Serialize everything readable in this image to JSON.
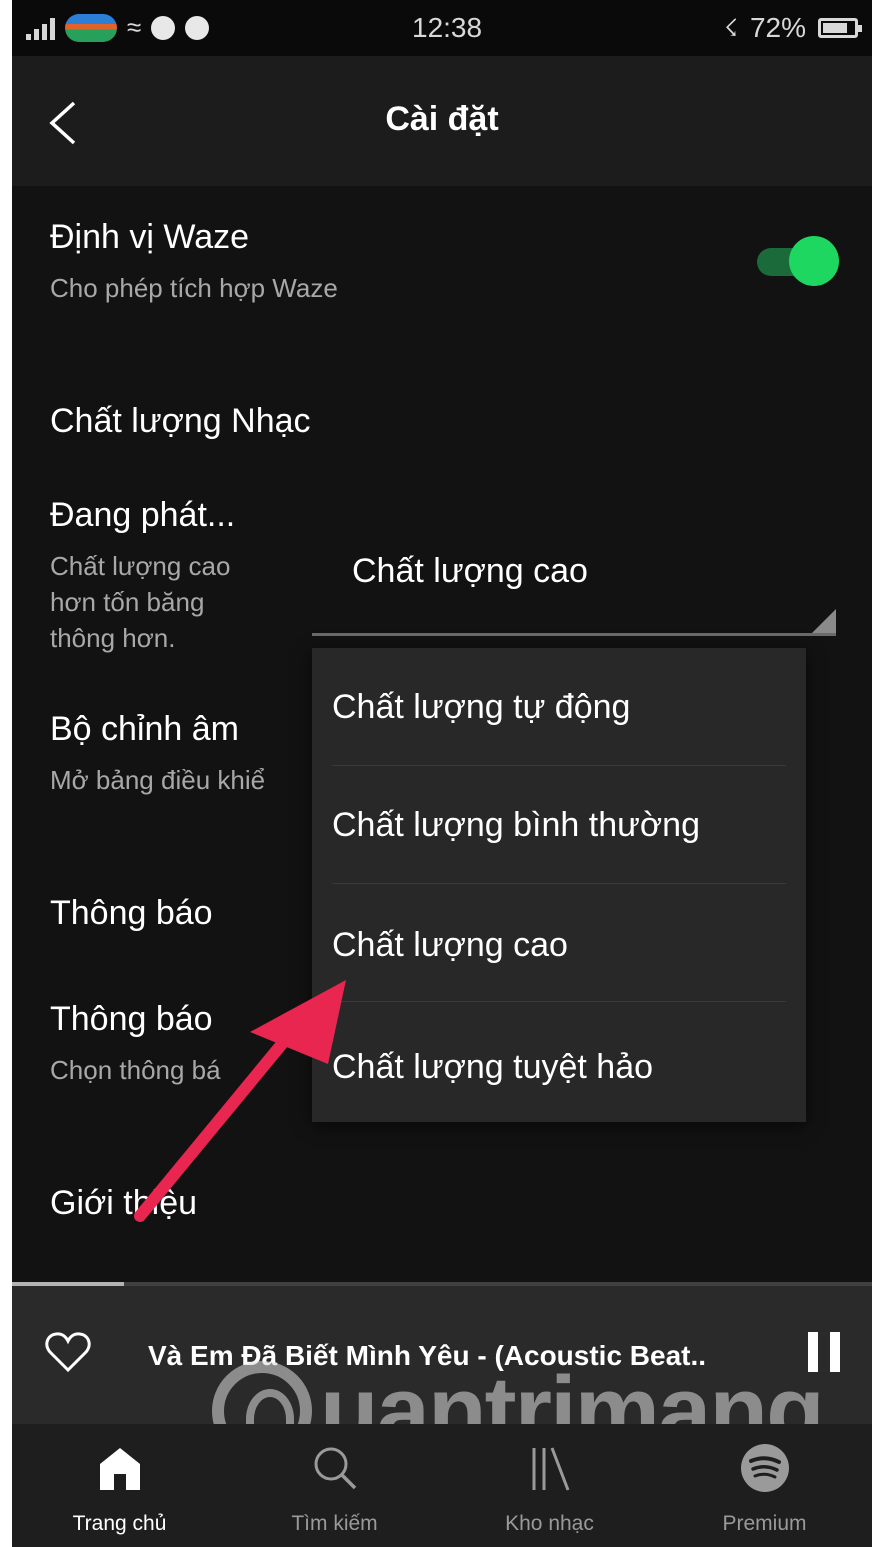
{
  "status_bar": {
    "time": "12:38",
    "battery": "72%"
  },
  "header": {
    "title": "Cài đặt",
    "back_icon": "chevron-left-icon"
  },
  "settings": {
    "waze": {
      "title": "Định vị Waze",
      "subtitle": "Cho phép tích hợp Waze",
      "enabled": true
    },
    "music_quality_heading": "Chất lượng Nhạc",
    "streaming": {
      "title": "Đang phát...",
      "subtitle_lines": [
        "Chất lượng cao",
        "hơn tốn băng",
        "thông hơn."
      ]
    },
    "equalizer": {
      "title": "Bộ chỉnh âm",
      "subtitle": "Mở bảng điều khiể"
    },
    "notifications_heading": "Thông báo",
    "notifications": {
      "title": "Thông báo",
      "subtitle": "Chọn thông bá"
    },
    "about": {
      "title": "Giới thiệu"
    }
  },
  "quality_select": {
    "value": "Chất lượng cao",
    "options": [
      "Chất lượng tự động",
      "Chất lượng bình thường",
      "Chất lượng cao",
      "Chất lượng tuyệt hảo"
    ]
  },
  "player": {
    "track": "Và Em Đã Biết Mình Yêu - (Acoustic Beat..",
    "progress": 0.13
  },
  "watermark": "uantrimang",
  "bottom_nav": [
    {
      "label": "Trang chủ",
      "icon": "home-icon",
      "active": true
    },
    {
      "label": "Tìm kiếm",
      "icon": "search-icon",
      "active": false
    },
    {
      "label": "Kho nhạc",
      "icon": "library-icon",
      "active": false
    },
    {
      "label": "Premium",
      "icon": "spotify-icon",
      "active": false
    }
  ],
  "colors": {
    "background": "#121212",
    "accent": "#1ed760",
    "annotation_arrow": "#e8264f"
  }
}
